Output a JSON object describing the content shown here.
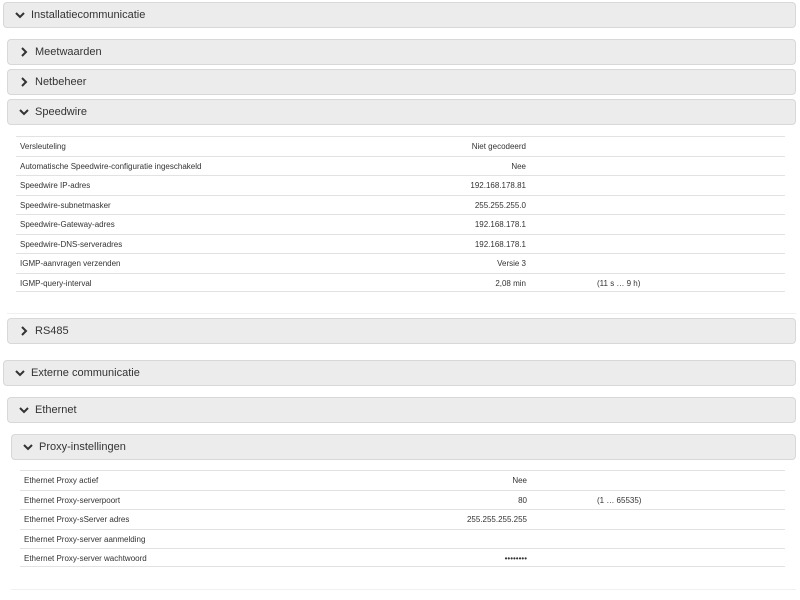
{
  "sections": {
    "installation": "Installatiecommunicatie",
    "measurements": "Meetwaarden",
    "grid": "Netbeheer",
    "speedwire": "Speedwire",
    "rs485": "RS485",
    "external": "Externe communicatie",
    "ethernet": "Ethernet",
    "proxy": "Proxy-instellingen"
  },
  "speedwire_rows": [
    {
      "label": "Versleuteling",
      "value": "Niet gecodeerd",
      "range": ""
    },
    {
      "label": "Automatische Speedwire-configuratie ingeschakeld",
      "value": "Nee",
      "range": ""
    },
    {
      "label": "Speedwire IP-adres",
      "value": "192.168.178.81",
      "range": ""
    },
    {
      "label": "Speedwire-subnetmasker",
      "value": "255.255.255.0",
      "range": ""
    },
    {
      "label": "Speedwire-Gateway-adres",
      "value": "192.168.178.1",
      "range": ""
    },
    {
      "label": "Speedwire-DNS-serveradres",
      "value": "192.168.178.1",
      "range": ""
    },
    {
      "label": "IGMP-aanvragen verzenden",
      "value": "Versie 3",
      "range": ""
    },
    {
      "label": "IGMP-query-interval",
      "value": "2,08 min",
      "range": "(11 s … 9 h)"
    }
  ],
  "proxy_rows": [
    {
      "label": "Ethernet Proxy actief",
      "value": "Nee",
      "range": ""
    },
    {
      "label": "Ethernet Proxy-serverpoort",
      "value": "80",
      "range": "(1 … 65535)"
    },
    {
      "label": "Ethernet Proxy-sServer adres",
      "value": "255.255.255.255",
      "range": ""
    },
    {
      "label": "Ethernet Proxy-server aanmelding",
      "value": "",
      "range": ""
    },
    {
      "label": "Ethernet Proxy-server wachtwoord",
      "value": "••••••••",
      "range": ""
    }
  ],
  "icons": {
    "expanded": "chevron-down-icon",
    "collapsed": "chevron-right-icon"
  }
}
